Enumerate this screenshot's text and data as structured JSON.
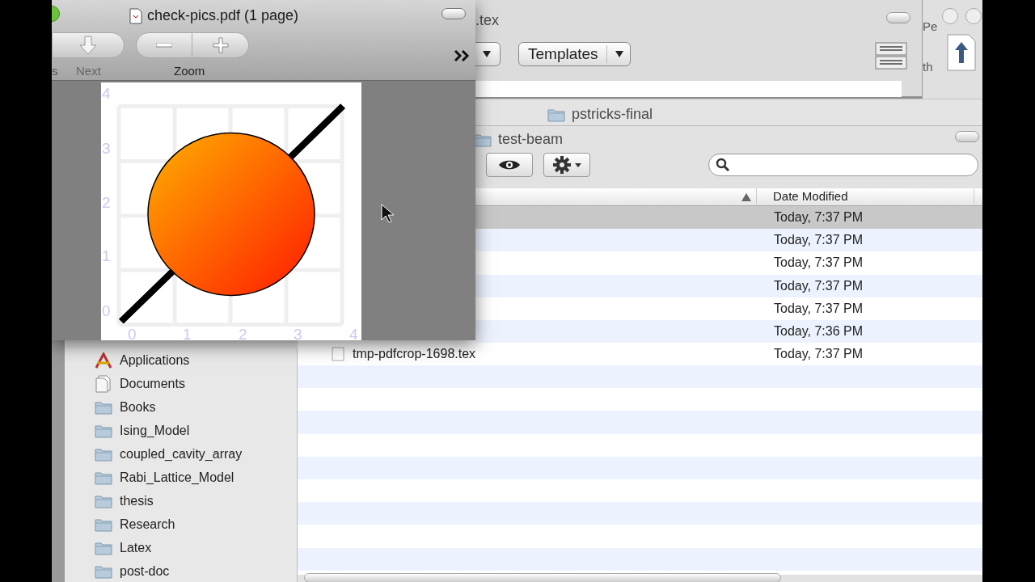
{
  "pdf_window": {
    "title": "check-pics.pdf (1 page)",
    "toolbar": [
      {
        "kind": "previous",
        "label": "s"
      },
      {
        "kind": "next",
        "label": "Next"
      },
      {
        "kind": "zoom",
        "label": "Zoom"
      }
    ],
    "page": {
      "y_axis_labels": [
        "4",
        "3",
        "2",
        "1",
        "0"
      ],
      "x_axis_labels": [
        "0",
        "1",
        "2",
        "3",
        "4"
      ]
    }
  },
  "tex_window": {
    "title": ".tex",
    "templates_button": "Templates"
  },
  "side_window": {
    "fragments": [
      "Pe",
      "th"
    ]
  },
  "back_window": {
    "title": "pstricks-final"
  },
  "finder": {
    "title": "test-beam",
    "columns": [
      "Date Modified"
    ],
    "sidebar": [
      {
        "kind": "applications",
        "label": "Applications"
      },
      {
        "kind": "documents",
        "label": "Documents"
      },
      {
        "kind": "folder",
        "label": "Books"
      },
      {
        "kind": "folder",
        "label": "Ising_Model"
      },
      {
        "kind": "folder",
        "label": "coupled_cavity_array"
      },
      {
        "kind": "folder",
        "label": "Rabi_Lattice_Model"
      },
      {
        "kind": "folder",
        "label": "thesis"
      },
      {
        "kind": "folder",
        "label": "Research"
      },
      {
        "kind": "folder",
        "label": "Latex"
      },
      {
        "kind": "folder",
        "label": "post-doc"
      }
    ],
    "rows": [
      {
        "date_modified": "Today, 7:37 PM",
        "selected": true
      },
      {
        "date_modified": "Today, 7:37 PM",
        "selected": false
      },
      {
        "date_modified": "Today, 7:37 PM",
        "selected": false
      },
      {
        "date_modified": "Today, 7:37 PM",
        "selected": false
      },
      {
        "date_modified": "Today, 7:37 PM",
        "selected": false
      },
      {
        "date_modified": "Today, 7:36 PM",
        "selected": false
      },
      {
        "name": "tmp-pdfcrop-1698.tex",
        "date_modified": "Today, 7:37 PM",
        "selected": false
      }
    ]
  }
}
